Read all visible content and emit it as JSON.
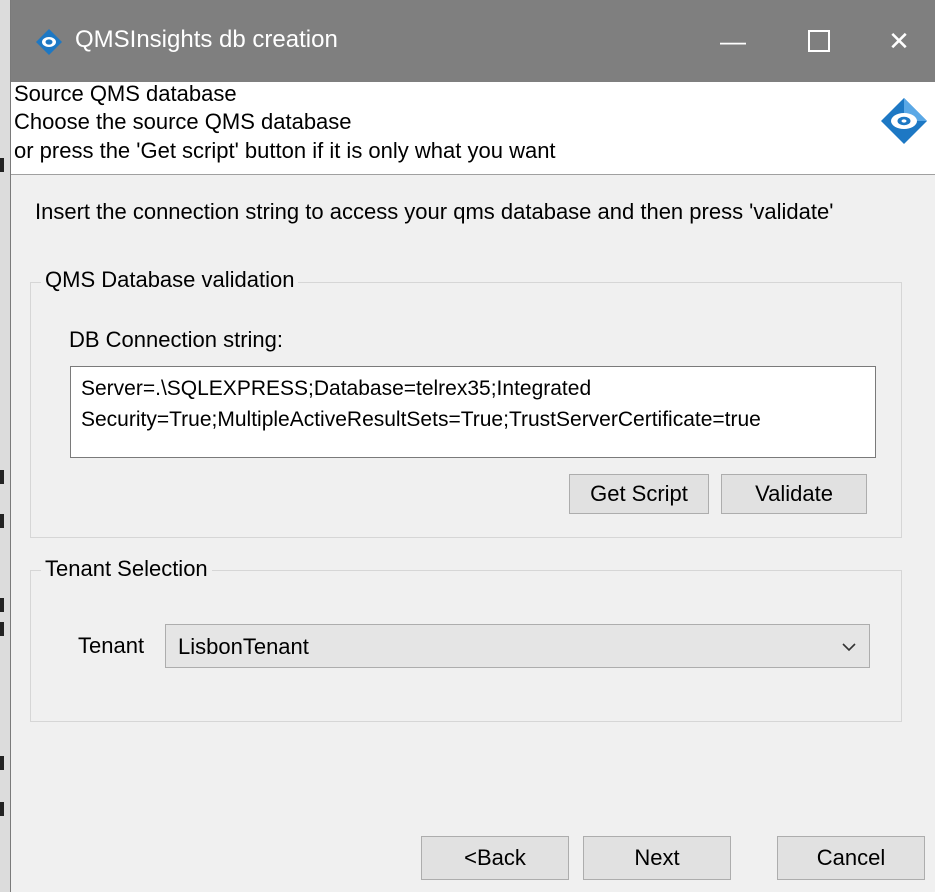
{
  "window": {
    "title": "QMSInsights db creation",
    "minimize_glyph": "—",
    "close_glyph": "✕"
  },
  "header": {
    "line1": "Source QMS database",
    "line2": "Choose the source QMS database",
    "line3": "or press the 'Get script' button if it is only what you want"
  },
  "instruction": "Insert the connection string to access your qms database and then press 'validate'",
  "validation_group": {
    "title": "QMS Database validation",
    "conn_label": "DB Connection string:",
    "conn_line1": "Server=.\\SQLEXPRESS;Database=telrex35;Integrated",
    "conn_line2": "Security=True;MultipleActiveResultSets=True;TrustServerCertificate=true",
    "get_script_label": "Get Script",
    "validate_label": "Validate"
  },
  "tenant_group": {
    "title": "Tenant Selection",
    "tenant_label": "Tenant",
    "tenant_value": "LisbonTenant"
  },
  "footer": {
    "back_label": "<Back",
    "next_label": "Next",
    "cancel_label": "Cancel"
  },
  "colors": {
    "titlebar": "#7f7f7f",
    "accent_blue": "#1d78c4"
  },
  "icons": [
    "app-icon",
    "logo-icon",
    "minimize-icon",
    "maximize-icon",
    "close-icon",
    "chevron-down-icon"
  ]
}
